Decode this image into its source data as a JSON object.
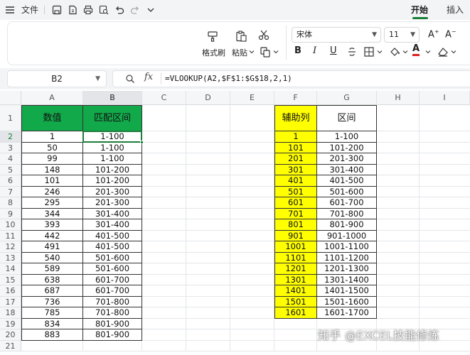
{
  "titlebar": {
    "file_label": "文件",
    "tabs": [
      {
        "label": "开始",
        "active": true
      },
      {
        "label": "插入",
        "active": false
      }
    ]
  },
  "ribbon": {
    "format_painter_label": "格式刷",
    "paste_label": "粘贴",
    "font_name": "宋体",
    "font_size": "11",
    "bold_label": "B",
    "italic_label": "I",
    "underline_label": "U",
    "font_color_label": "A",
    "grow_font_label": "A",
    "shrink_font_label": "A",
    "font_color_hex": "#e02020"
  },
  "formula_bar": {
    "name_box": "B2",
    "fx_label": "fx",
    "formula": "=VLOOKUP(A2,$F$1:$G$18,2,1)"
  },
  "grid": {
    "columns": [
      "A",
      "B",
      "C",
      "D",
      "E",
      "F",
      "G",
      "H",
      "I"
    ],
    "rows": [
      "1",
      "2",
      "3",
      "4",
      "5",
      "6",
      "7",
      "8",
      "9",
      "10",
      "11",
      "12",
      "13",
      "14",
      "15",
      "16",
      "17",
      "18",
      "19",
      "20",
      "21"
    ],
    "selected_column": "B",
    "selected_row": "2",
    "header_A": "数值",
    "header_B": "匹配区间",
    "header_F": "辅助列",
    "header_G": "区间",
    "colA": [
      "1",
      "50",
      "99",
      "148",
      "101",
      "246",
      "295",
      "344",
      "393",
      "442",
      "491",
      "540",
      "589",
      "638",
      "687",
      "736",
      "785",
      "834",
      "883"
    ],
    "colB": [
      "1-100",
      "1-100",
      "1-100",
      "101-200",
      "101-200",
      "201-300",
      "201-300",
      "301-400",
      "301-400",
      "401-500",
      "401-500",
      "501-600",
      "501-600",
      "601-700",
      "601-700",
      "701-800",
      "701-800",
      "801-900",
      "801-900"
    ],
    "colF": [
      "1",
      "101",
      "201",
      "301",
      "401",
      "501",
      "601",
      "701",
      "801",
      "901",
      "1001",
      "1101",
      "1201",
      "1301",
      "1401",
      "1501",
      "1601"
    ],
    "colG": [
      "1-100",
      "101-200",
      "201-300",
      "301-400",
      "401-500",
      "501-600",
      "601-700",
      "701-800",
      "801-900",
      "901-1000",
      "1001-1100",
      "1101-1200",
      "1201-1300",
      "1301-1400",
      "1401-1500",
      "1501-1600",
      "1601-1700"
    ],
    "colors": {
      "green_header": "#12a94a",
      "yellow_fill": "#ffff00",
      "active_border": "#1e7d3a"
    }
  },
  "watermark": "知乎 @EXCEL技能修炼"
}
